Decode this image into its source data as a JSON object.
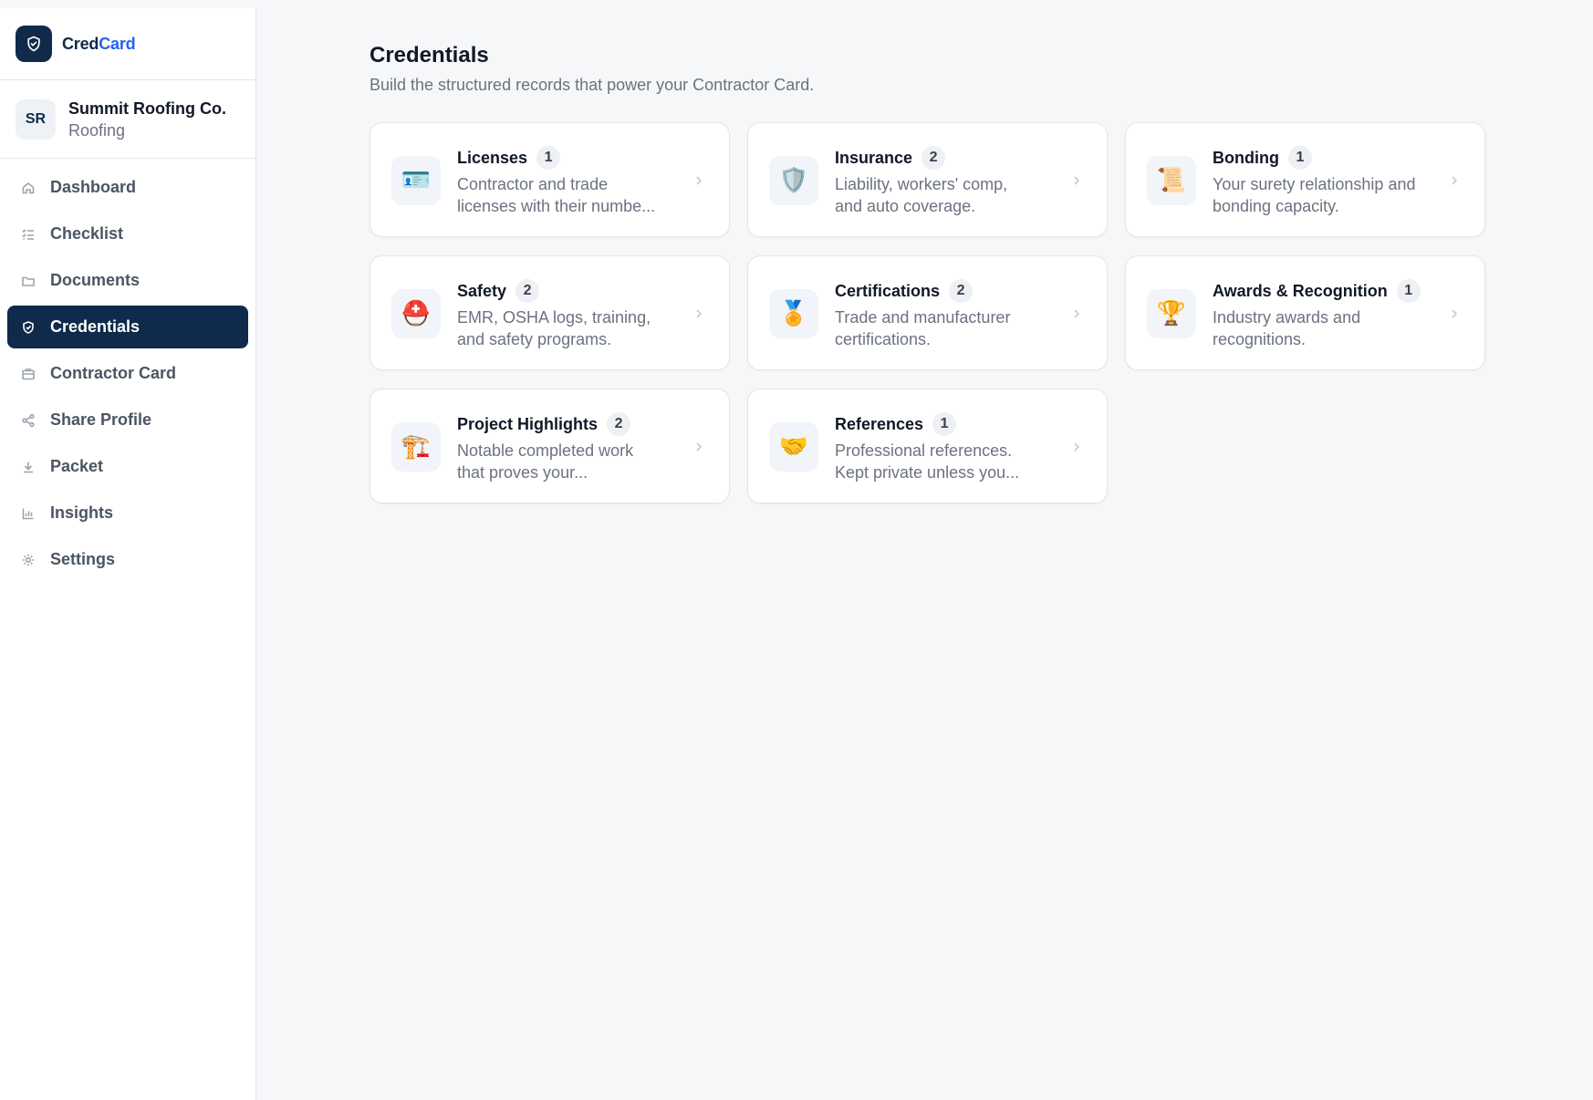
{
  "brand": {
    "name_part1": "Cred",
    "name_part2": "Card"
  },
  "org": {
    "initials": "SR",
    "name": "Summit Roofing Co.",
    "trade": "Roofing"
  },
  "nav": [
    {
      "label": "Dashboard",
      "icon": "home-icon"
    },
    {
      "label": "Checklist",
      "icon": "checklist-icon"
    },
    {
      "label": "Documents",
      "icon": "folder-icon"
    },
    {
      "label": "Credentials",
      "icon": "shield-icon",
      "active": true
    },
    {
      "label": "Contractor Card",
      "icon": "card-icon"
    },
    {
      "label": "Share Profile",
      "icon": "share-icon"
    },
    {
      "label": "Packet",
      "icon": "download-icon"
    },
    {
      "label": "Insights",
      "icon": "bar-chart-icon"
    },
    {
      "label": "Settings",
      "icon": "gear-icon"
    }
  ],
  "page": {
    "title": "Credentials",
    "subtitle": "Build the structured records that power your Contractor Card."
  },
  "cards": [
    {
      "title": "Licenses",
      "count": "1",
      "desc_line1": "Contractor and trade",
      "desc_line2": "licenses with their numbe...",
      "icon": "id-card-icon",
      "glyph": "🪪"
    },
    {
      "title": "Insurance",
      "count": "2",
      "desc_line1": "Liability, workers' comp,",
      "desc_line2": "and auto coverage.",
      "icon": "shield-icon",
      "glyph": "🛡️"
    },
    {
      "title": "Bonding",
      "count": "1",
      "desc_line1": "Your surety relationship and",
      "desc_line2": "bonding capacity.",
      "icon": "scroll-icon",
      "glyph": "📜"
    },
    {
      "title": "Safety",
      "count": "2",
      "desc_line1": "EMR, OSHA logs, training,",
      "desc_line2": "and safety programs.",
      "icon": "rescue-helmet-icon",
      "glyph": "⛑️"
    },
    {
      "title": "Certifications",
      "count": "2",
      "desc_line1": "Trade and manufacturer",
      "desc_line2": "certifications.",
      "icon": "medal-icon",
      "glyph": "🏅"
    },
    {
      "title": "Awards & Recognition",
      "count": "1",
      "desc_line1": "Industry awards and",
      "desc_line2": "recognitions.",
      "icon": "trophy-icon",
      "glyph": "🏆"
    },
    {
      "title": "Project Highlights",
      "count": "2",
      "desc_line1": "Notable completed work",
      "desc_line2": "that proves your...",
      "icon": "crane-icon",
      "glyph": "🏗️"
    },
    {
      "title": "References",
      "count": "1",
      "desc_line1": "Professional references.",
      "desc_line2": "Kept private unless you...",
      "icon": "handshake-icon",
      "glyph": "🤝"
    }
  ]
}
